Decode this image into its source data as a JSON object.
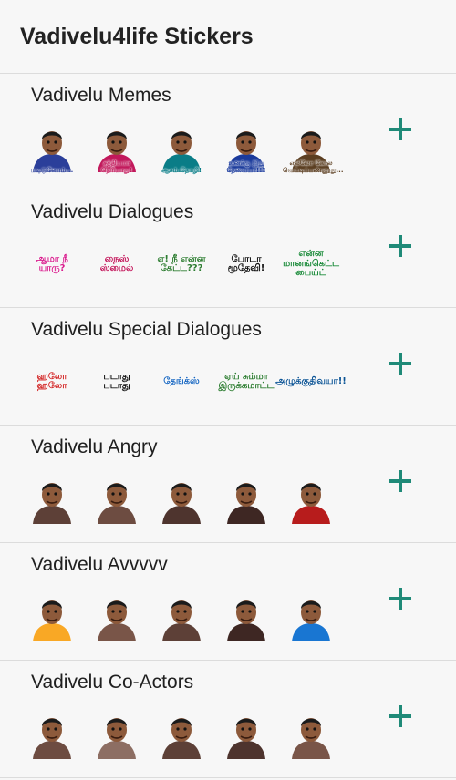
{
  "app": {
    "title": "Vadivelu4life Stickers"
  },
  "colors": {
    "accent": "#1f8a78",
    "divider": "#dcdcdc",
    "background": "#f7f7f7"
  },
  "packs": [
    {
      "name": "Vadivelu Memes",
      "stickers": [
        {
          "kind": "face",
          "caption": "மடிடுனோம்...",
          "color": "#2b3f9a"
        },
        {
          "kind": "face",
          "caption": "சத்தியமா தெரியாது!",
          "color": "#c2185b"
        },
        {
          "kind": "face",
          "caption": "ஆசம் தோழி!",
          "color": "#0a7d87"
        },
        {
          "kind": "face",
          "caption": "உனக்கு இது தேவையா!!?",
          "color": "#1a3a9c"
        },
        {
          "kind": "face",
          "caption": "எல்லோ கோல வெட்டிப்பண்ணுது...",
          "color": "#5b3e21"
        }
      ]
    },
    {
      "name": "Vadivelu Dialogues",
      "stickers": [
        {
          "kind": "text",
          "caption": "ஆமா நீ யாரு?",
          "color": "#d81b8c"
        },
        {
          "kind": "text",
          "caption": "நைஸ் ஸ்மைல்",
          "color": "#c2185b"
        },
        {
          "kind": "text",
          "caption": "ஏ! நீ என்ன கேட்ட???",
          "color": "#2e7d32"
        },
        {
          "kind": "text",
          "caption": "போடா மூதேவி!",
          "color": "#111111"
        },
        {
          "kind": "text",
          "caption": "என்ன மானங்கெட்ட பைய்ட்",
          "color": "#1b8a3a"
        }
      ]
    },
    {
      "name": "Vadivelu Special Dialogues",
      "stickers": [
        {
          "kind": "text",
          "caption": "ஹலோ ஹலோ",
          "color": "#d32f2f"
        },
        {
          "kind": "text",
          "caption": "படாது படாது",
          "color": "#111111"
        },
        {
          "kind": "text",
          "caption": "தேங்க்ஸ்",
          "color": "#1565c0"
        },
        {
          "kind": "text",
          "caption": "ஏய் சும்மா இருக்கமாட்ட",
          "color": "#2e7d32"
        },
        {
          "kind": "text",
          "caption": "அழுக்குதிவயா!!",
          "color": "#0b5394"
        }
      ]
    },
    {
      "name": "Vadivelu Angry",
      "stickers": [
        {
          "kind": "face",
          "caption": "",
          "color": "#5d4037"
        },
        {
          "kind": "face",
          "caption": "",
          "color": "#6d4c41"
        },
        {
          "kind": "face",
          "caption": "",
          "color": "#4e342e"
        },
        {
          "kind": "face",
          "caption": "",
          "color": "#3e2723"
        },
        {
          "kind": "face",
          "caption": "",
          "color": "#b71c1c"
        }
      ]
    },
    {
      "name": "Vadivelu Avvvvv",
      "stickers": [
        {
          "kind": "face",
          "caption": "",
          "color": "#f9a825"
        },
        {
          "kind": "face",
          "caption": "",
          "color": "#795548"
        },
        {
          "kind": "face",
          "caption": "",
          "color": "#5d4037"
        },
        {
          "kind": "face",
          "caption": "",
          "color": "#3e2723"
        },
        {
          "kind": "face",
          "caption": "",
          "color": "#1976d2"
        }
      ]
    },
    {
      "name": "Vadivelu Co-Actors",
      "stickers": [
        {
          "kind": "face",
          "caption": "",
          "color": "#6d4c41"
        },
        {
          "kind": "face",
          "caption": "",
          "color": "#8d6e63"
        },
        {
          "kind": "face",
          "caption": "",
          "color": "#5d4037"
        },
        {
          "kind": "face",
          "caption": "",
          "color": "#4e342e"
        },
        {
          "kind": "face",
          "caption": "",
          "color": "#795548"
        }
      ]
    }
  ]
}
